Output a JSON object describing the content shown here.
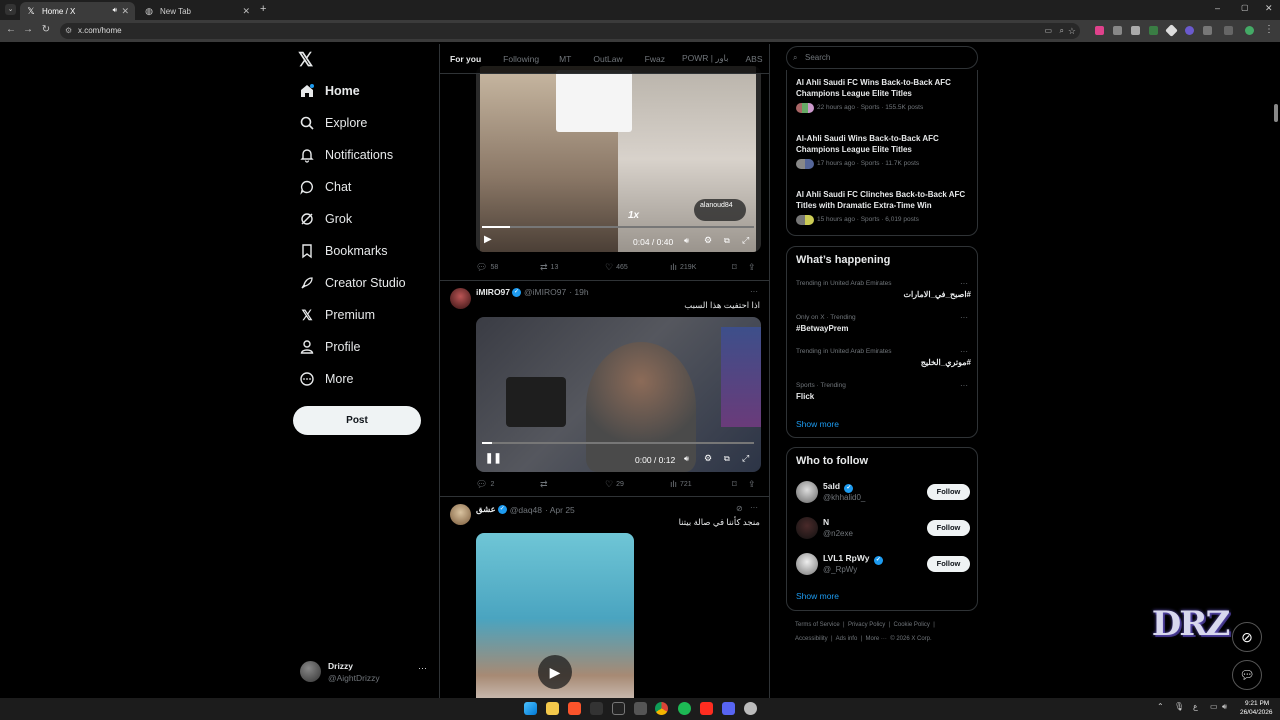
{
  "browser": {
    "tabs": [
      {
        "label": "Home / X"
      },
      {
        "label": "New Tab"
      }
    ],
    "url": "x.com/home"
  },
  "sidebar": {
    "items": [
      {
        "label": "Home"
      },
      {
        "label": "Explore"
      },
      {
        "label": "Notifications"
      },
      {
        "label": "Chat"
      },
      {
        "label": "Grok"
      },
      {
        "label": "Bookmarks"
      },
      {
        "label": "Creator Studio"
      },
      {
        "label": "Premium"
      },
      {
        "label": "Profile"
      },
      {
        "label": "More"
      }
    ],
    "post_label": "Post",
    "account": {
      "name": "Drizzy",
      "handle": "@AightDrizzy"
    }
  },
  "feed": {
    "tabs": [
      "For you",
      "Following",
      "MT",
      "OutLaw",
      "Fwaz",
      "POWR | باور",
      "ABS"
    ],
    "tweets": [
      {
        "video_time": "0:04 / 0:40",
        "overlay_watermark": "alanoud84",
        "speed": "1x",
        "replies": "58",
        "retweets": "13",
        "likes": "465",
        "views": "219K"
      },
      {
        "name": "iMIRO97",
        "handle": "@iMIRO97",
        "time": "· 19h",
        "text": "اذا احتفيت هذا السبب",
        "video_time": "0:00 / 0:12",
        "replies": "2",
        "retweets": "",
        "likes": "29",
        "views": "721"
      },
      {
        "name": "عشق",
        "handle": "@daq48",
        "time": "· Apr 25",
        "text": "منجد كأننا في صالة بيتنا"
      }
    ]
  },
  "right": {
    "search_placeholder": "Search",
    "news": [
      {
        "title": "Al Ahli Saudi FC Wins Back-to-Back AFC Champions League Elite Titles",
        "meta": "22 hours ago · Sports · 155.5K posts"
      },
      {
        "title": "Al-Ahli Saudi Wins Back-to-Back AFC Champions League Elite Titles",
        "meta": "17 hours ago · Sports · 11.7K posts"
      },
      {
        "title": "Al Ahli Saudi FC Clinches Back-to-Back AFC Titles with Dramatic Extra-Time Win",
        "meta": "15 hours ago · Sports · 6,019 posts"
      }
    ],
    "happening_title": "What’s happening",
    "trends": [
      {
        "context": "Trending in United Arab Emirates",
        "name": "#اصبح_في_الامارات"
      },
      {
        "context": "Only on X · Trending",
        "name": "#BetwayPrem"
      },
      {
        "context": "Trending in United Arab Emirates",
        "name": "#موتري_الخليج"
      },
      {
        "context": "Sports · Trending",
        "name": "Flick"
      }
    ],
    "show_more": "Show more",
    "follow_title": "Who to follow",
    "follow": [
      {
        "name": "5ald",
        "handle": "@khhalid0_",
        "verified": true
      },
      {
        "name": "N",
        "handle": "@n2exe",
        "verified": false
      },
      {
        "name": "LVL1 RpWy",
        "handle": "@_RpWy",
        "verified": true
      }
    ],
    "follow_label": "Follow",
    "footer": {
      "line1": [
        "Terms of Service",
        "|",
        "Privacy Policy",
        "|",
        "Cookie Policy",
        "|"
      ],
      "line2": [
        "Accessibility",
        "|",
        "Ads info",
        "|",
        "More ···",
        "© 2026 X Corp."
      ]
    }
  },
  "overlay_logo": "DRZ",
  "taskbar": {
    "time": "9:21 PM",
    "date": "26/04/2026"
  },
  "colors": {
    "accent": "#1d9bf0",
    "background": "#000000",
    "border": "#2f3336"
  }
}
